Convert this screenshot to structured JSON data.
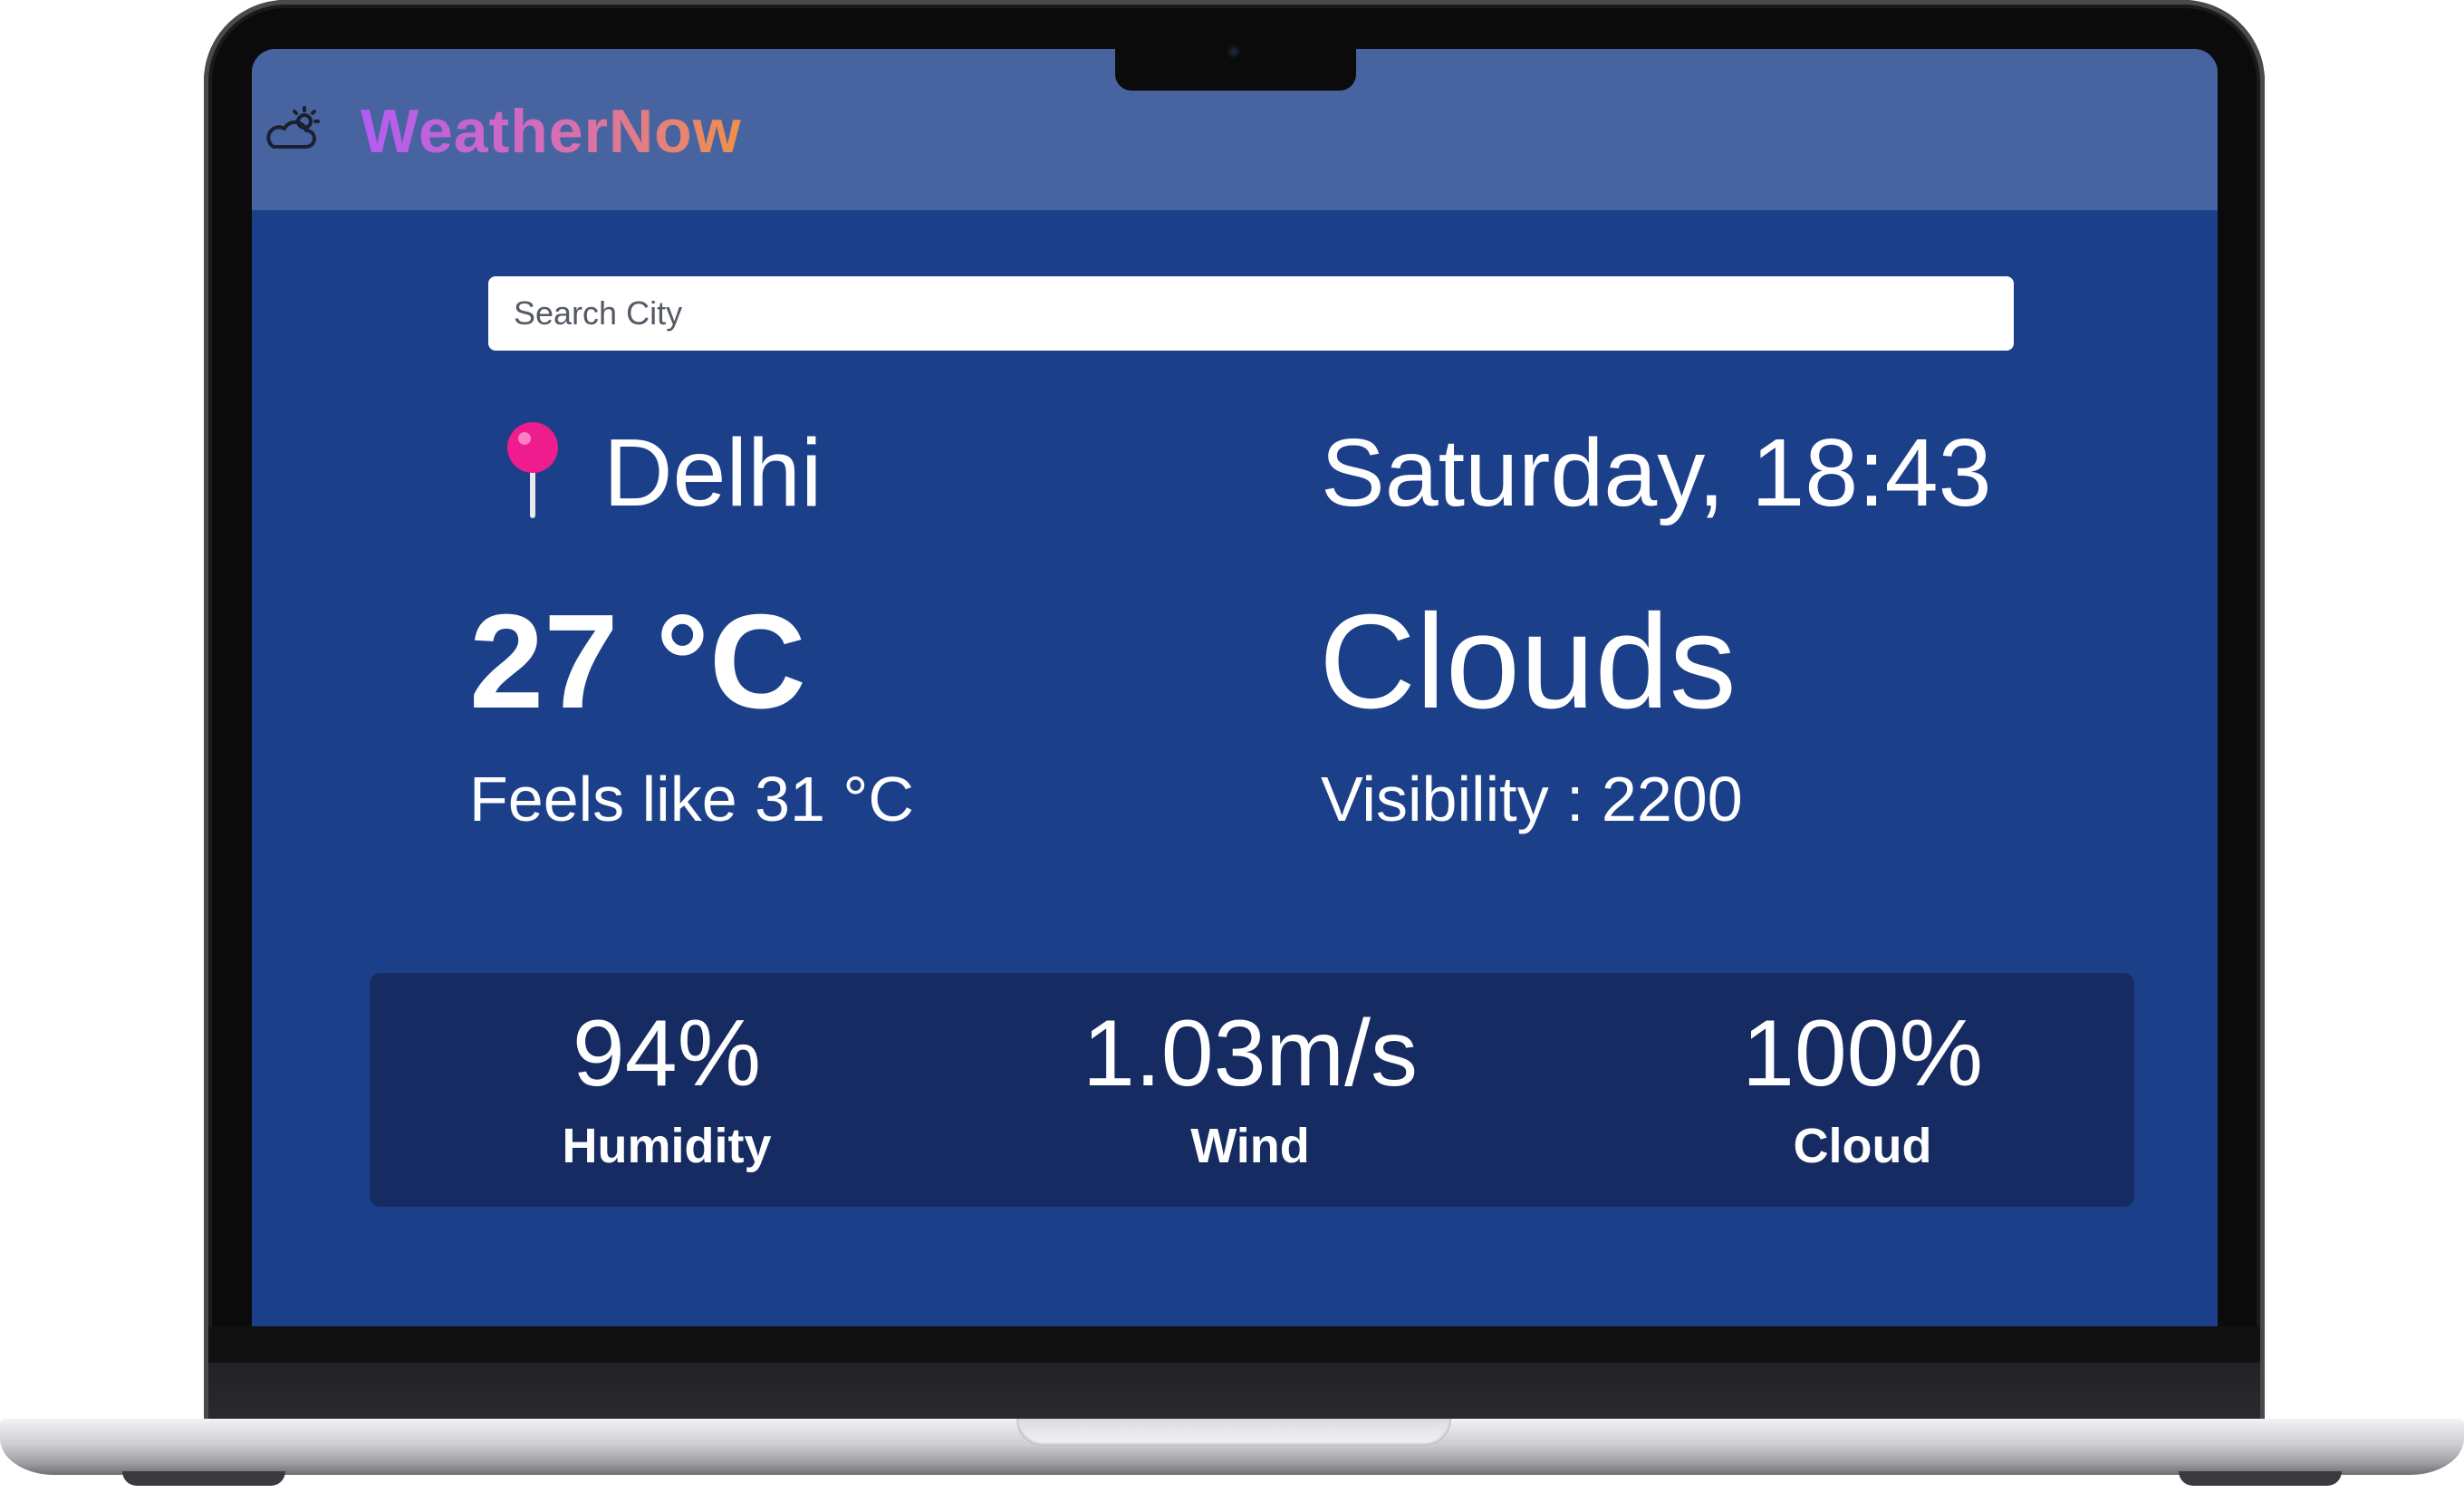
{
  "header": {
    "brand_title": "WeatherNow",
    "brand_icon": "cloud-sun-icon",
    "title_gradient": [
      "#b35cf2",
      "#d86fb0",
      "#f0904a"
    ]
  },
  "search": {
    "placeholder": "Search City",
    "value": ""
  },
  "location": {
    "icon": "location-pin-icon",
    "city": "Delhi"
  },
  "datetime": "Saturday, 18:43",
  "weather": {
    "temperature": "27 °C",
    "condition": "Clouds",
    "feels_like": "Feels like 31 °C",
    "visibility": "Visibility : 2200"
  },
  "stats": [
    {
      "value": "94%",
      "label": "Humidity"
    },
    {
      "value": "1.03m/s",
      "label": "Wind"
    },
    {
      "value": "100%",
      "label": "Cloud"
    }
  ],
  "colors": {
    "background": "#1c3f8a",
    "header": "#4764a1",
    "stats_panel": "#152b62",
    "pin": "#ee1c8c",
    "text": "#ffffff"
  }
}
